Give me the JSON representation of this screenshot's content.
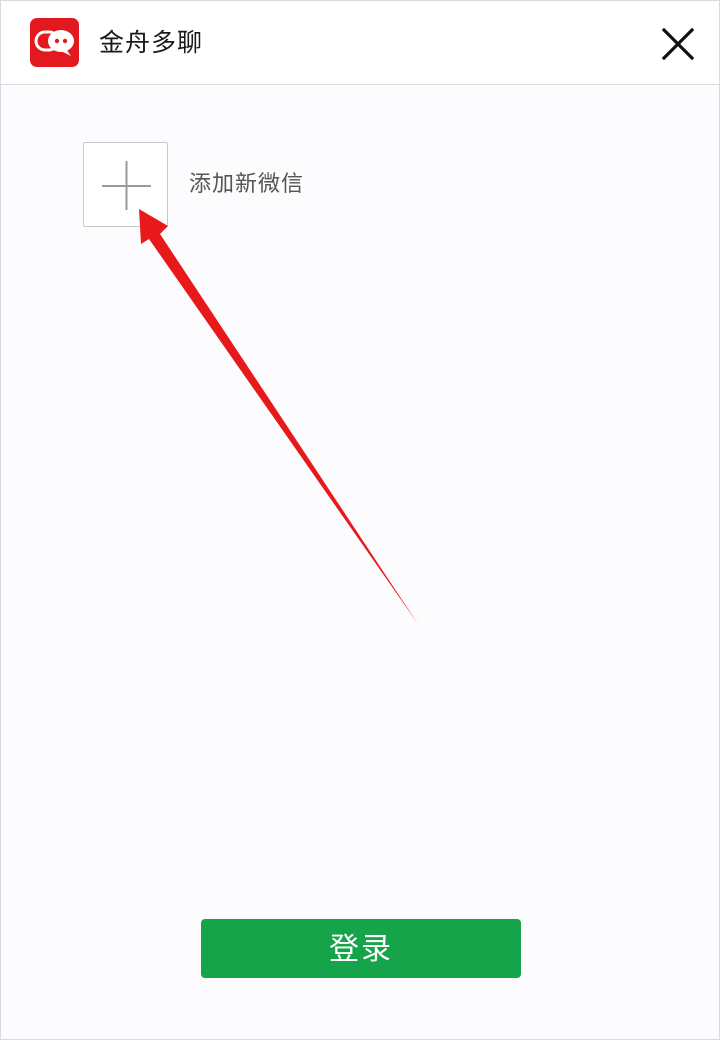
{
  "titlebar": {
    "app_icon": "red-chat-bubble-app-icon",
    "app_title": "金舟多聊",
    "close_icon": "close-x-icon"
  },
  "accounts": {
    "add_tile_icon": "plus-icon",
    "add_label": "添加新微信"
  },
  "annotation": {
    "arrow_icon": "red-arrow-pointer",
    "arrow_color": "#e8191a"
  },
  "footer": {
    "login_label": "登录"
  },
  "colors": {
    "accent_green": "#15a449",
    "brand_red": "#e21a1f"
  }
}
